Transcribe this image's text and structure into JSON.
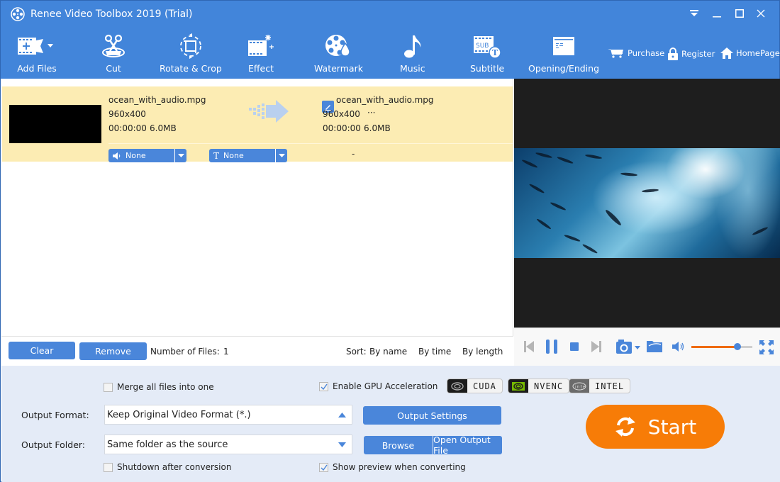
{
  "window": {
    "title": "Renee Video Toolbox 2019 (Trial)",
    "controls": [
      "dropdown-menu",
      "minimize",
      "maximize",
      "close"
    ]
  },
  "toolbar": {
    "items": [
      {
        "label": "Add Files",
        "icon": "add-files-icon"
      },
      {
        "label": "Cut",
        "icon": "scissors-icon"
      },
      {
        "label": "Rotate & Crop",
        "icon": "rotate-crop-icon"
      },
      {
        "label": "Effect",
        "icon": "effect-icon"
      },
      {
        "label": "Watermark",
        "icon": "watermark-icon"
      },
      {
        "label": "Music",
        "icon": "music-note-icon"
      },
      {
        "label": "Subtitle",
        "icon": "subtitle-icon"
      },
      {
        "label": "Opening/Ending",
        "icon": "opening-ending-icon"
      }
    ],
    "links": [
      {
        "label": "Purchase",
        "icon": "cart-icon"
      },
      {
        "label": "Register",
        "icon": "lock-icon"
      },
      {
        "label": "HomePage",
        "icon": "home-icon"
      }
    ]
  },
  "file_list": {
    "files": [
      {
        "source": {
          "name": "ocean_with_audio.mpg",
          "resolution": "960x400",
          "duration": "00:00:00",
          "size": "6.0MB"
        },
        "output": {
          "name": "ocean_with_audio.mpg",
          "resolution": "960x400",
          "extra": "···",
          "duration": "00:00:00",
          "size": "6.0MB"
        },
        "audio_track": "None",
        "subtitle_track": "None",
        "output_extra": "-"
      }
    ],
    "clear_label": "Clear",
    "remove_label": "Remove",
    "count_label": "Number of Files:",
    "count_value": "1",
    "sort_label": "Sort:",
    "sort_options": [
      "By name",
      "By time",
      "By length"
    ]
  },
  "player": {
    "volume_percent": 75,
    "buttons": [
      "previous",
      "pause",
      "stop",
      "next",
      "snapshot",
      "open-folder",
      "volume",
      "fullscreen"
    ]
  },
  "settings": {
    "merge_label": "Merge all files into one",
    "merge_checked": false,
    "gpu_label": "Enable GPU Acceleration",
    "gpu_checked": true,
    "gpu_badges": [
      "CUDA",
      "NVENC",
      "INTEL"
    ],
    "output_format_label": "Output Format:",
    "output_format_value": "Keep Original Video Format (*.)",
    "output_settings_label": "Output Settings",
    "output_folder_label": "Output Folder:",
    "output_folder_value": "Same folder as the source",
    "browse_label": "Browse",
    "open_output_label": "Open Output File",
    "shutdown_label": "Shutdown after conversion",
    "shutdown_checked": false,
    "preview_label": "Show preview when converting",
    "preview_checked": true,
    "start_label": "Start"
  },
  "colors": {
    "primary": "#4285da",
    "button": "#4a86da",
    "accent_orange": "#f77c07",
    "row_highlight": "#fcecb3",
    "settings_bg": "#e4ebf7"
  }
}
